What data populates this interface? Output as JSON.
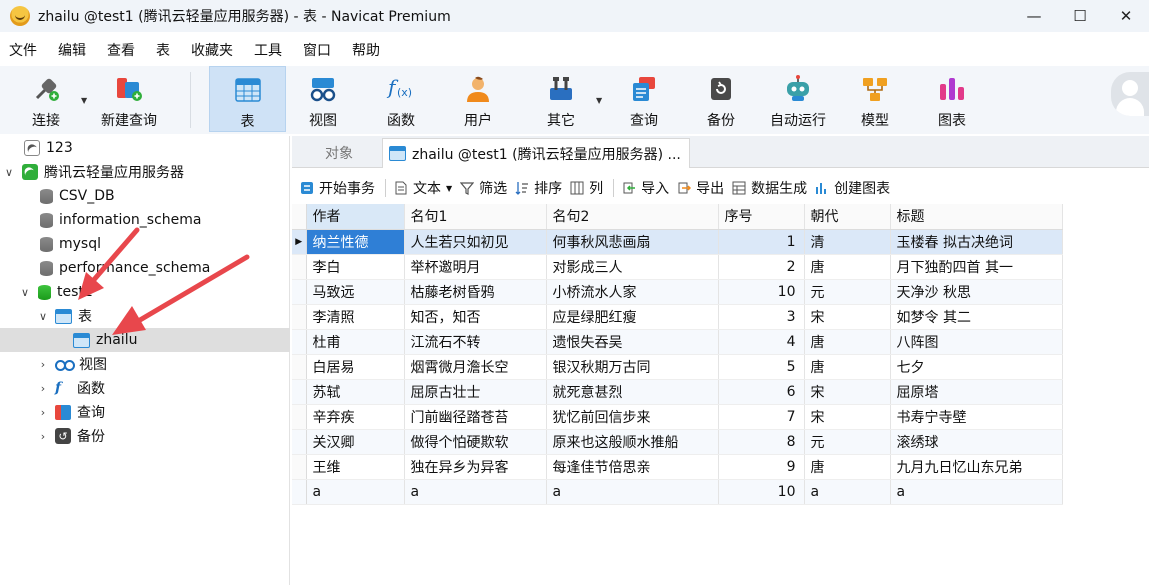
{
  "window": {
    "title": "zhailu @test1 (腾讯云轻量应用服务器) - 表 - Navicat Premium",
    "minimize": "—",
    "maximize": "☐",
    "close": "✕"
  },
  "menu": [
    "文件",
    "编辑",
    "查看",
    "表",
    "收藏夹",
    "工具",
    "窗口",
    "帮助"
  ],
  "toolbar": {
    "connect": "连接",
    "new_query": "新建查询",
    "table": "表",
    "view": "视图",
    "function": "函数",
    "user": "用户",
    "other": "其它",
    "query": "查询",
    "backup": "备份",
    "automation": "自动运行",
    "model": "模型",
    "chart": "图表"
  },
  "tree": {
    "conn_123": "123",
    "conn_tencent": "腾讯云轻量应用服务器",
    "db_csv": "CSV_DB",
    "db_info": "information_schema",
    "db_mysql": "mysql",
    "db_perf": "performance_schema",
    "db_test1": "test1",
    "node_tables": "表",
    "table_zhailu": "zhailu",
    "node_views": "视图",
    "node_functions": "函数",
    "node_queries": "查询",
    "node_backups": "备份"
  },
  "tabs": {
    "objects": "对象",
    "active": "zhailu @test1 (腾讯云轻量应用服务器) ..."
  },
  "subtoolbar": {
    "begin_txn": "开始事务",
    "text": "文本",
    "filter": "筛选",
    "sort": "排序",
    "columns": "列",
    "import": "导入",
    "export": "导出",
    "datagen": "数据生成",
    "create_chart": "创建图表"
  },
  "grid": {
    "headers": [
      "作者",
      "名句1",
      "名句2",
      "序号",
      "朝代",
      "标题"
    ],
    "rows": [
      [
        "纳兰性德",
        "人生若只如初见",
        "何事秋风悲画扇",
        "1",
        "清",
        "玉楼春  拟古决绝词"
      ],
      [
        "李白",
        "举杯邀明月",
        "对影成三人",
        "2",
        "唐",
        "月下独酌四首 其一"
      ],
      [
        "马致远",
        "枯藤老树昏鸦",
        "小桥流水人家",
        "10",
        "元",
        "天净沙 秋思"
      ],
      [
        "李清照",
        "知否，知否",
        "应是绿肥红瘦",
        "3",
        "宋",
        "如梦令 其二"
      ],
      [
        "杜甫",
        "江流石不转",
        "遗恨失吞吴",
        "4",
        "唐",
        "八阵图"
      ],
      [
        "白居易",
        "烟霄微月澹长空",
        "银汉秋期万古同",
        "5",
        "唐",
        "七夕"
      ],
      [
        "苏轼",
        "屈原古壮士",
        "就死意甚烈",
        "6",
        "宋",
        "屈原塔"
      ],
      [
        "辛弃疾",
        "门前幽径踏苍苔",
        "犹忆前回信步来",
        "7",
        "宋",
        "书寿宁寺壁"
      ],
      [
        "关汉卿",
        "做得个怕硬欺软",
        "原来也这般顺水推船",
        "8",
        "元",
        "滚绣球"
      ],
      [
        "王维",
        "独在异乡为异客",
        "每逢佳节倍思亲",
        "9",
        "唐",
        "九月九日忆山东兄弟"
      ],
      [
        "a",
        "a",
        "a",
        "10",
        "a",
        "a"
      ]
    ]
  }
}
